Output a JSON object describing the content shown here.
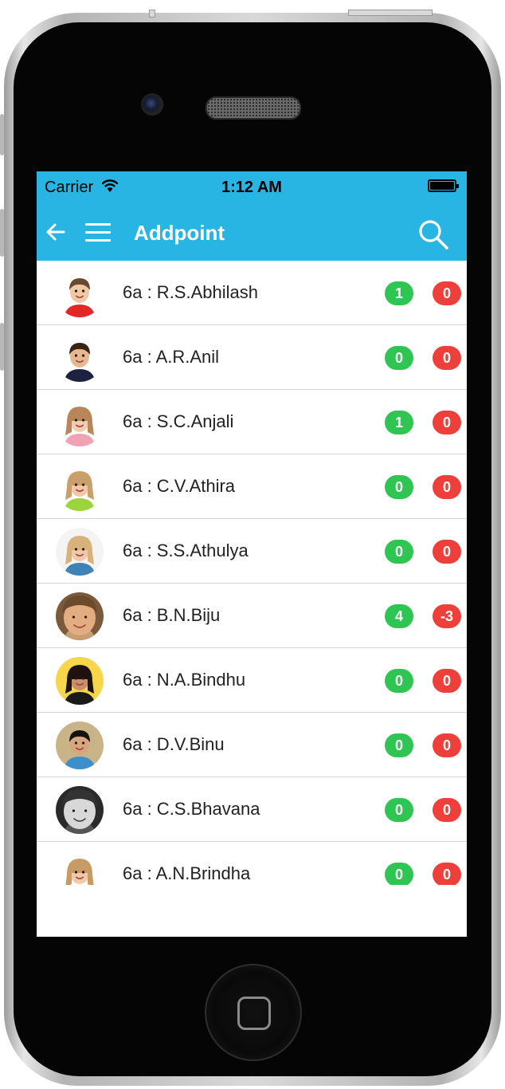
{
  "status_bar": {
    "carrier": "Carrier",
    "time": "1:12 AM"
  },
  "header": {
    "title": "Addpoint"
  },
  "icons": {
    "back": "arrow-left-icon",
    "menu": "hamburger-menu-icon",
    "search": "search-icon",
    "wifi": "wifi-icon",
    "battery": "battery-icon"
  },
  "colors": {
    "accent": "#29b5e4",
    "positive_badge": "#2fc552",
    "negative_badge": "#ef3f3b"
  },
  "students": [
    {
      "label": "6a : R.S.Abhilash",
      "positive": "1",
      "negative": "0",
      "avatar": "boy-red-shirt"
    },
    {
      "label": "6a : A.R.Anil",
      "positive": "0",
      "negative": "0",
      "avatar": "boy-profile"
    },
    {
      "label": "6a : S.C.Anjali",
      "positive": "1",
      "negative": "0",
      "avatar": "girl-pink"
    },
    {
      "label": "6a : C.V.Athira",
      "positive": "0",
      "negative": "0",
      "avatar": "girl-green"
    },
    {
      "label": "6a : S.S.Athulya",
      "positive": "0",
      "negative": "0",
      "avatar": "girl-scarf"
    },
    {
      "label": "6a : B.N.Biju",
      "positive": "4",
      "negative": "-3",
      "avatar": "boy-closeup"
    },
    {
      "label": "6a : N.A.Bindhu",
      "positive": "0",
      "negative": "0",
      "avatar": "girl-colorful"
    },
    {
      "label": "6a : D.V.Binu",
      "positive": "0",
      "negative": "0",
      "avatar": "boy-smiling"
    },
    {
      "label": "6a : C.S.Bhavana",
      "positive": "0",
      "negative": "0",
      "avatar": "girl-grayscale"
    },
    {
      "label": "6a : A.N.Brindha",
      "positive": "0",
      "negative": "0",
      "avatar": "girl-blue"
    }
  ]
}
